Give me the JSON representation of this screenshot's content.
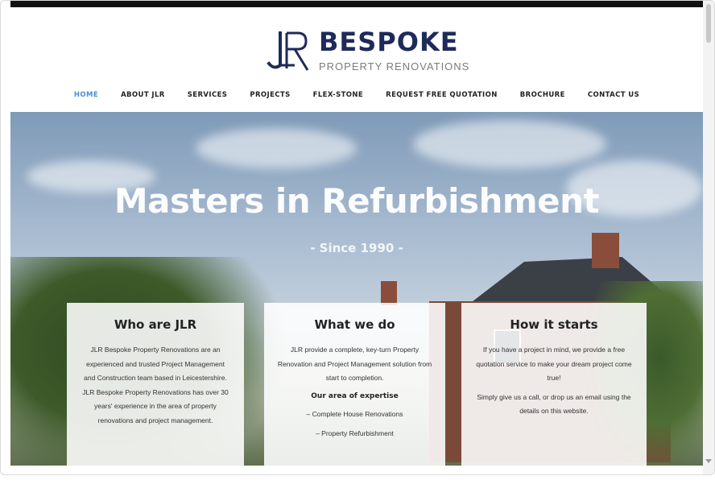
{
  "logo": {
    "word": "BESPOKE",
    "sub": "PROPERTY RENOVATIONS",
    "mark_letters": "JLR"
  },
  "nav": {
    "items": [
      {
        "label": "HOME",
        "active": true
      },
      {
        "label": "ABOUT JLR",
        "active": false
      },
      {
        "label": "SERVICES",
        "active": false
      },
      {
        "label": "PROJECTS",
        "active": false
      },
      {
        "label": "FLEX-STONE",
        "active": false
      },
      {
        "label": "REQUEST FREE QUOTATION",
        "active": false
      },
      {
        "label": "BROCHURE",
        "active": false
      },
      {
        "label": "CONTACT US",
        "active": false
      }
    ]
  },
  "hero": {
    "title": "Masters in Refurbishment",
    "subtitle": "- Since 1990 -"
  },
  "cards": [
    {
      "title": "Who are JLR",
      "body": "JLR Bespoke Property Renovations are an experienced and trusted Project Management and Construction team based in Leicestershire. JLR Bespoke Property Renovations has over 30 years' experience in the area of property renovations and project management."
    },
    {
      "title": "What we do",
      "body": "JLR provide a complete, key-turn Property Renovation and Project Management solution from start to completion.",
      "subheading": "Our area of expertise",
      "list": [
        "– Complete House Renovations",
        "– Property Refurbishment"
      ]
    },
    {
      "title": "How it starts",
      "body": "If you have a project in mind, we provide a free quotation service to make your dream project come true!",
      "body2": "Simply give us a call, or drop us an email using the details on this website."
    }
  ],
  "colors": {
    "brand_navy": "#1e2a5a",
    "nav_active": "#4a8fd6"
  }
}
